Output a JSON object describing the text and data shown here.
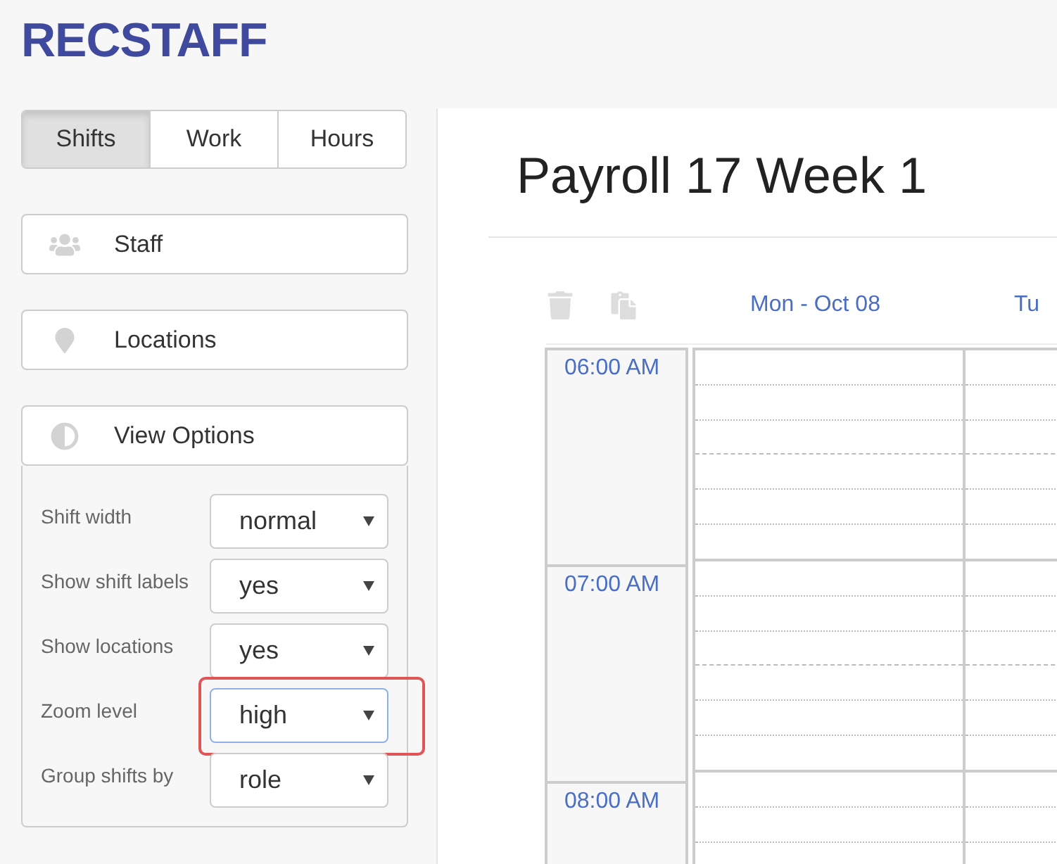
{
  "logo": "RECSTAFF",
  "tabs": [
    {
      "label": "Shifts",
      "selected": true
    },
    {
      "label": "Work",
      "selected": false
    },
    {
      "label": "Hours",
      "selected": false
    }
  ],
  "panels": [
    {
      "label": "Staff",
      "kind": "staff"
    },
    {
      "label": "Locations",
      "kind": "locations"
    },
    {
      "label": "View Options",
      "kind": "view"
    }
  ],
  "view_options": [
    {
      "label": "Shift width",
      "value": "normal",
      "highlighted": false
    },
    {
      "label": "Show shift labels",
      "value": "yes",
      "highlighted": false
    },
    {
      "label": "Show locations",
      "value": "yes",
      "highlighted": false
    },
    {
      "label": "Zoom level",
      "value": "high",
      "highlighted": true
    },
    {
      "label": "Group shifts by",
      "value": "role",
      "highlighted": false
    }
  ],
  "title": "Payroll 17 Week 1",
  "days": [
    "Mon - Oct 08",
    "Tu"
  ],
  "times": [
    "06:00 AM",
    "07:00 AM",
    "08:00 AM"
  ]
}
